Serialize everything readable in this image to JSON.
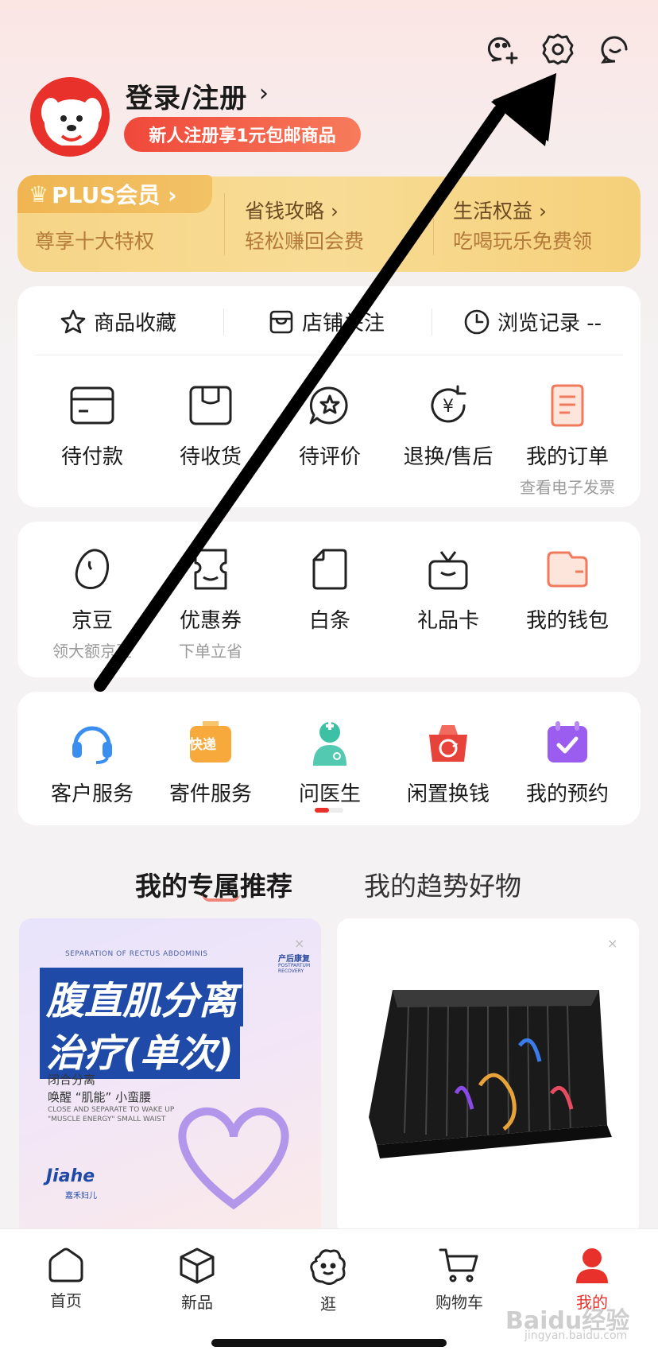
{
  "header": {
    "login_label": "登录/注册",
    "login_arrow": "›",
    "promo": "新人注册享1元包邮商品"
  },
  "plus": {
    "tag": "PLUS会员 ›",
    "items": [
      {
        "title": "",
        "sub": "尊享十大特权"
      },
      {
        "title": "省钱攻略 ›",
        "sub": "轻松赚回会费"
      },
      {
        "title": "生活权益 ›",
        "sub": "吃喝玩乐免费领"
      }
    ]
  },
  "favorites": {
    "items": [
      {
        "label": "商品收藏"
      },
      {
        "label": "店铺关注"
      },
      {
        "label": "浏览记录 --"
      }
    ]
  },
  "orders": {
    "items": [
      {
        "label": "待付款"
      },
      {
        "label": "待收货"
      },
      {
        "label": "待评价"
      },
      {
        "label": "退换/售后"
      },
      {
        "label": "我的订单",
        "sub": "查看电子发票"
      }
    ]
  },
  "wallet": {
    "items": [
      {
        "label": "京豆",
        "sub": "领大额京豆"
      },
      {
        "label": "优惠券",
        "sub": "下单立省"
      },
      {
        "label": "白条"
      },
      {
        "label": "礼品卡"
      },
      {
        "label": "我的钱包"
      }
    ]
  },
  "services": {
    "items": [
      {
        "label": "客户服务"
      },
      {
        "label": "寄件服务",
        "badge": "快递"
      },
      {
        "label": "问医生"
      },
      {
        "label": "闲置换钱"
      },
      {
        "label": "我的预约"
      }
    ]
  },
  "recommend": {
    "tab_active": "我的专属推荐",
    "tab_other": "我的趋势好物"
  },
  "product1": {
    "en_top": "SEPARATION OF RECTUS ABDOMINIS",
    "badge1": "产后康复",
    "badge2": "POSTPARTUM RECOVERY",
    "title_line1": "腹直肌分离",
    "title_line2": "治疗(单次)",
    "desc1": "闭合分离",
    "desc2": "唤醒 “肌能” 小蛮腰",
    "en1": "CLOSE AND SEPARATE TO WAKE UP",
    "en2": "\"MUSCLE ENERGY\" SMALL WAIST",
    "brand": "Jiahe",
    "brand_cn": "嘉禾妇儿",
    "close": "×"
  },
  "product2": {
    "close": "×"
  },
  "nav": {
    "items": [
      {
        "label": "首页"
      },
      {
        "label": "新品"
      },
      {
        "label": "逛"
      },
      {
        "label": "购物车"
      },
      {
        "label": "我的"
      }
    ],
    "active_color": "#e8312a"
  },
  "watermark": {
    "text": "Baidu经验",
    "url": "jingyan.baidu.com"
  },
  "colors": {
    "accent": "#e8312a",
    "plus_gold": "#f6d587"
  }
}
